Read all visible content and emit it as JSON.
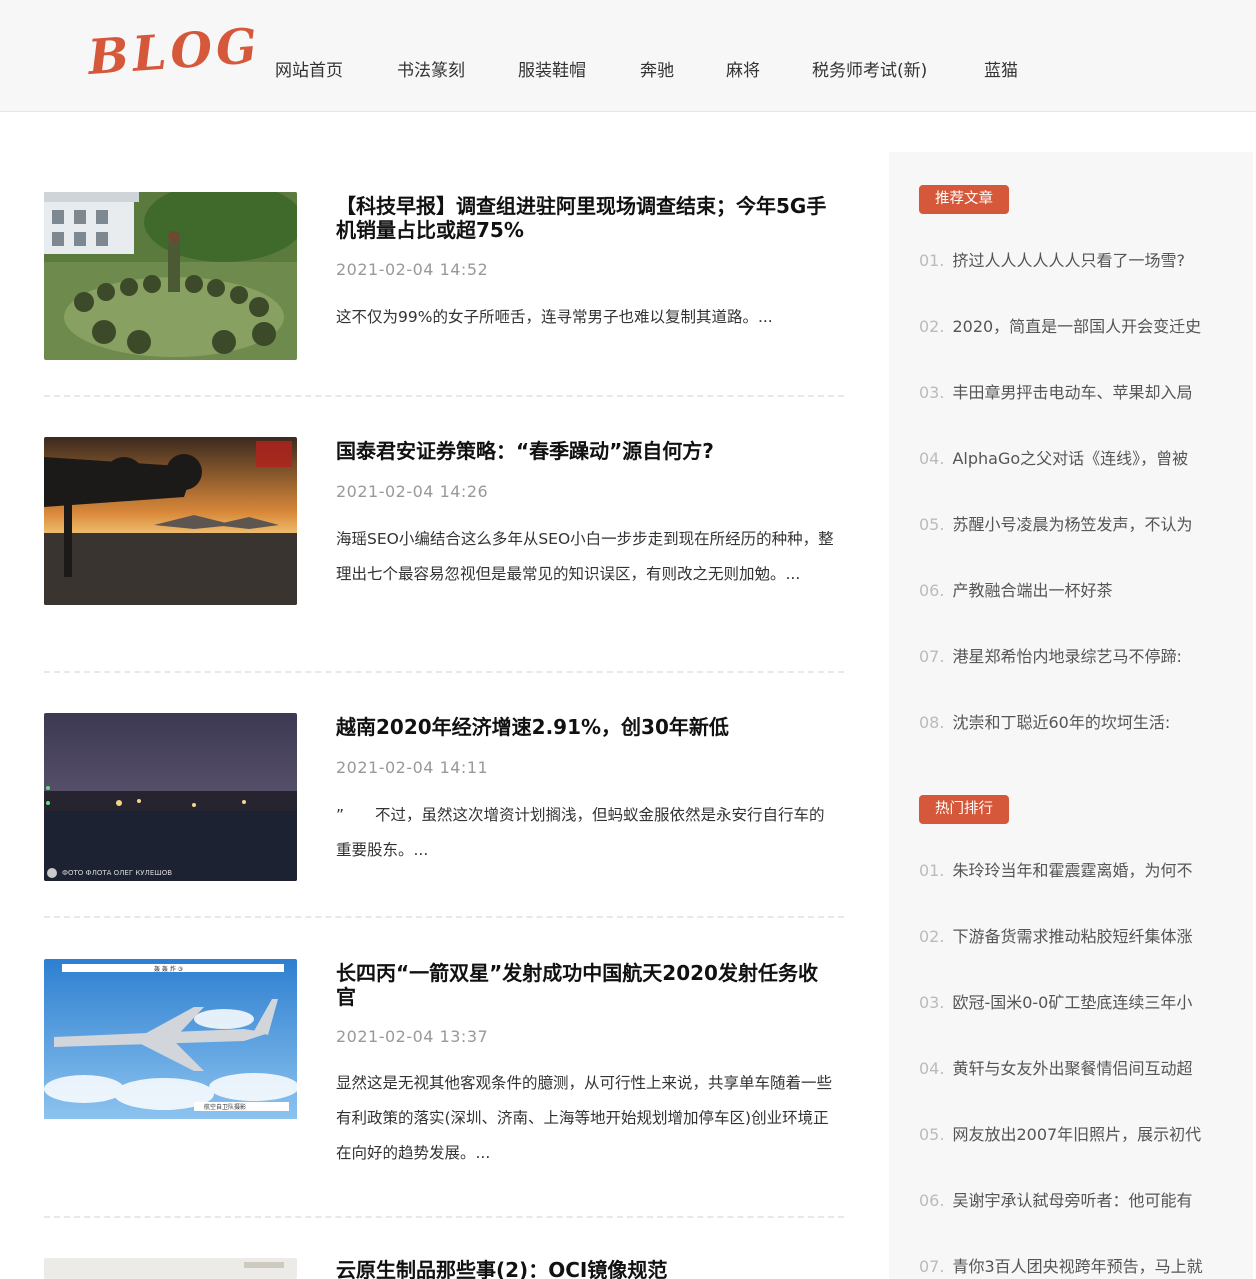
{
  "logo": "BLOG",
  "nav": [
    "网站首页",
    "书法篆刻",
    "服装鞋帽",
    "奔驰",
    "麻将",
    "税务师考试(新)",
    "蓝猫"
  ],
  "articles": [
    {
      "title": "【科技早报】调查组进驻阿里现场调查结束；今年5G手机销量占比或超75%",
      "date": "2021-02-04 14:52",
      "summary": "这不仅为99%的女子所咂舌，连寻常男子也难以复制其道路。..."
    },
    {
      "title": "国泰君安证券策略：“春季躁动”源自何方?",
      "date": "2021-02-04 14:26",
      "summary": "海瑶SEO小编结合这么多年从SEO小白一步步走到现在所经历的种种，整理出七个最容易忽视但是最常见的知识误区，有则改之无则加勉。..."
    },
    {
      "title": "越南2020年经济增速2.91%，创30年新低",
      "date": "2021-02-04 14:11",
      "summary": "”　　不过，虽然这次增资计划搁浅，但蚂蚁金服依然是永安行自行车的重要股东。..."
    },
    {
      "title": "长四丙“一箭双星”发射成功中国航天2020发射任务收官",
      "date": "2021-02-04 13:37",
      "summary": "显然这是无视其他客观条件的臆测，从可行性上来说，共享单车随着一些有利政策的落实(深圳、济南、上海等地开始规划增加停车区)创业环境正在向好的趋势发展。..."
    },
    {
      "title": "云原生制品那些事(2)：OCI镜像规范",
      "date": "",
      "summary": ""
    }
  ],
  "thumb_captions": {
    "night_photo": "ФОТО ФЛОТА  ОЛЕГ КУЛЕШОВ",
    "plane_top": "轰 轰 炸 ③",
    "plane_bottom": "航空自卫队摄影"
  },
  "sidebar": {
    "recommended": {
      "heading": "推荐文章",
      "items": [
        {
          "num": "01.",
          "text": "挤过人人人人人人只看了一场雪?"
        },
        {
          "num": "02.",
          "text": "2020，简直是一部国人开会变迁史"
        },
        {
          "num": "03.",
          "text": "丰田章男抨击电动车、苹果却入局"
        },
        {
          "num": "04.",
          "text": "AlphaGo之父对话《连线》，曾被"
        },
        {
          "num": "05.",
          "text": "苏醒小号凌晨为杨笠发声，不认为"
        },
        {
          "num": "06.",
          "text": "产教融合端出一杯好茶"
        },
        {
          "num": "07.",
          "text": "港星郑希怡内地录综艺马不停蹄:"
        },
        {
          "num": "08.",
          "text": "沈崇和丁聪近60年的坎坷生活:"
        }
      ]
    },
    "hot": {
      "heading": "热门排行",
      "items": [
        {
          "num": "01.",
          "text": "朱玲玲当年和霍震霆离婚，为何不"
        },
        {
          "num": "02.",
          "text": "下游备货需求推动粘胶短纤集体涨"
        },
        {
          "num": "03.",
          "text": "欧冠-国米0-0矿工垫底连续三年小"
        },
        {
          "num": "04.",
          "text": "黄轩与女友外出聚餐情侣间互动超"
        },
        {
          "num": "05.",
          "text": "网友放出2007年旧照片，展示初代"
        },
        {
          "num": "06.",
          "text": "吴谢宇承认弑母旁听者：他可能有"
        },
        {
          "num": "07.",
          "text": "青你3百人团央视跨年预告，马上就"
        }
      ]
    }
  },
  "colors": {
    "accent": "#d6583b",
    "sidebar_bg": "#f7f7f7",
    "header_bg": "#f7f7f7"
  }
}
